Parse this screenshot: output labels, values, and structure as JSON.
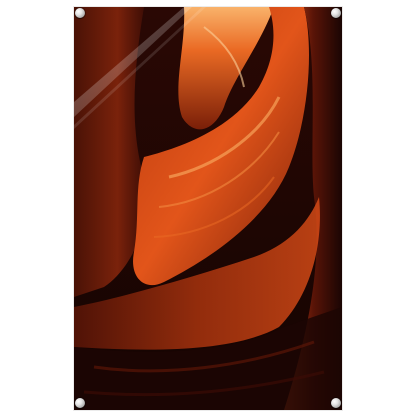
{
  "product": {
    "type": "acrylic-glass-print",
    "subject": "slot-canyon-sandstone",
    "colors": {
      "background": "#ffffff",
      "deep_shadow": "#1a0503",
      "rock_dark": "#3a0c05",
      "rock_mid": "#8a2a0c",
      "rock_glow": "#e2551a",
      "rock_highlight": "#f7a25a",
      "screw_metal": "#d0d0d0"
    },
    "mounting": [
      "screw-top-left",
      "screw-top-right",
      "screw-bottom-left",
      "screw-bottom-right"
    ]
  }
}
